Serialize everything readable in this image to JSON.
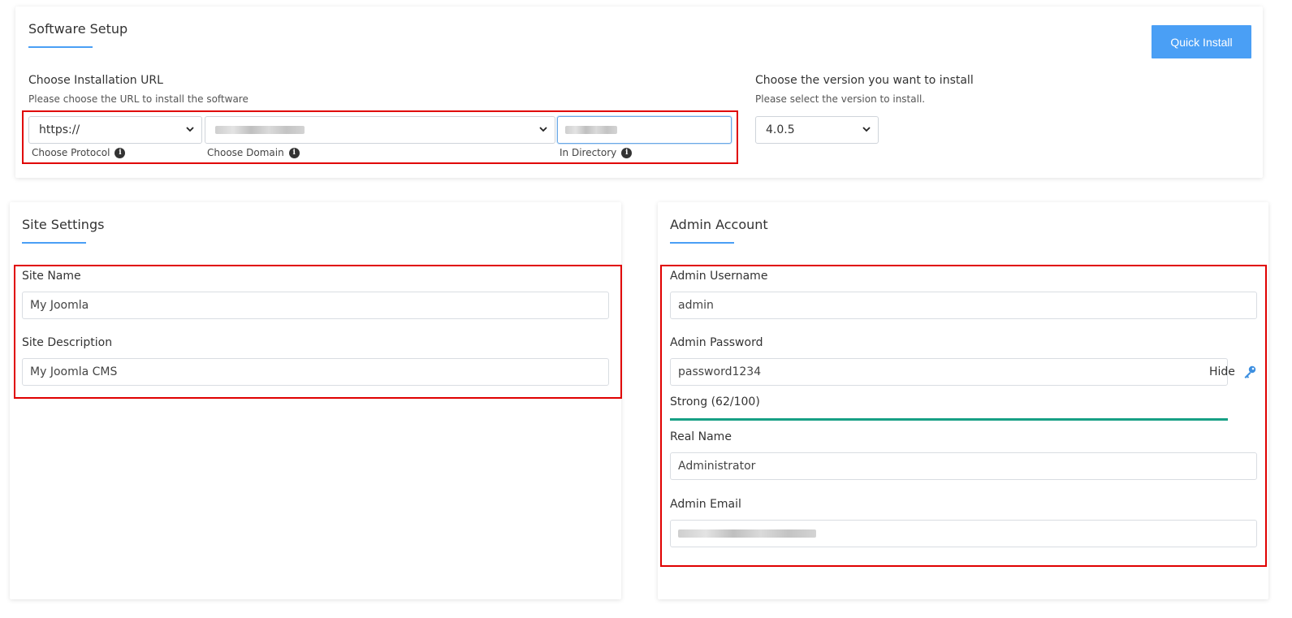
{
  "software_setup": {
    "title": "Software Setup",
    "quick_install_label": "Quick Install",
    "install_url": {
      "heading": "Choose Installation URL",
      "subheading": "Please choose the URL to install the software",
      "protocol_value": "https://",
      "protocol_hint": "Choose Protocol",
      "domain_hint": "Choose Domain",
      "directory_hint": "In Directory"
    },
    "version": {
      "heading": "Choose the version you want to install",
      "subheading": "Please select the version to install.",
      "value": "4.0.5"
    }
  },
  "site_settings": {
    "title": "Site Settings",
    "site_name_label": "Site Name",
    "site_name_value": "My Joomla",
    "site_description_label": "Site Description",
    "site_description_value": "My Joomla CMS"
  },
  "admin_account": {
    "title": "Admin Account",
    "username_label": "Admin Username",
    "username_value": "admin",
    "password_label": "Admin Password",
    "password_value": "password1234",
    "hide_label": "Hide",
    "strength_text": "Strong (62/100)",
    "strength_fraction": 0.62,
    "real_name_label": "Real Name",
    "real_name_value": "Administrator",
    "email_label": "Admin Email"
  },
  "colors": {
    "accent": "#4a9ff5",
    "highlight_box": "#e00000",
    "strength_bar": "#17a085"
  },
  "icons": {
    "info": "info-icon",
    "chevron": "chevron-down-icon",
    "key": "key-icon"
  }
}
